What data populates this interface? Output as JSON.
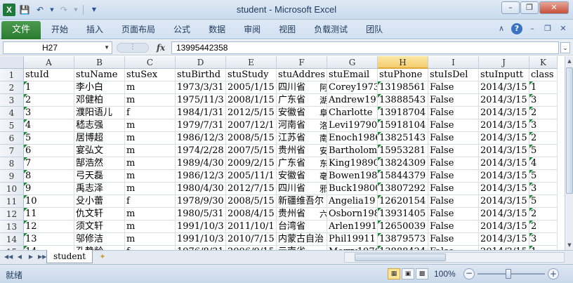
{
  "window": {
    "title": "student  -  Microsoft Excel",
    "icons": [
      "excel-icon",
      "save-icon",
      "undo-icon",
      "redo-icon",
      "minimize-icon",
      "restore-icon",
      "close-icon"
    ]
  },
  "ribbon": {
    "file_tab": "文件",
    "tabs": [
      "开始",
      "插入",
      "页面布局",
      "公式",
      "数据",
      "审阅",
      "视图",
      "负载测试",
      "团队"
    ]
  },
  "formula_bar": {
    "name_box": "H27",
    "fx": "fx",
    "value": "13995442358"
  },
  "columns": [
    "A",
    "B",
    "C",
    "D",
    "E",
    "F",
    "G",
    "H",
    "I",
    "J",
    "K"
  ],
  "selected_column": "H",
  "headers": [
    "stuId",
    "stuName",
    "stuSex",
    "stuBirthd",
    "stuStudy",
    "stuAddres",
    "stuEmail",
    "stuPhone",
    "stuIsDel",
    "stuInputt",
    "class"
  ],
  "rows": [
    [
      "1",
      "李小白",
      "m",
      "1973/3/31",
      "2005/1/15",
      "四川省",
      "阿",
      "Corey1973",
      "13198561",
      "False",
      "2014/3/15",
      "1"
    ],
    [
      "2",
      "邓健柏",
      "m",
      "1975/11/3",
      "2008/1/15",
      "广东省",
      "湖",
      "Andrew197",
      "13888543",
      "False",
      "2014/3/15",
      "3"
    ],
    [
      "3",
      "濮阳语儿",
      "f",
      "1984/1/31",
      "2012/5/15",
      "安徽省",
      "阜",
      "Charlotte",
      "13918704",
      "False",
      "2014/3/15",
      "2"
    ],
    [
      "4",
      "嵇志强",
      "m",
      "1979/7/31",
      "2007/12/1",
      "河南省",
      "洛",
      "Levi19790",
      "15918104",
      "False",
      "2014/3/15",
      "3"
    ],
    [
      "5",
      "居博超",
      "m",
      "1986/12/3",
      "2008/5/15",
      "江苏省",
      "南",
      "Enoch1986",
      "13825143",
      "False",
      "2014/3/15",
      "2"
    ],
    [
      "6",
      "宴弘文",
      "m",
      "1974/2/28",
      "2007/5/15",
      "贵州省",
      "安",
      "Bartholom",
      "15953281",
      "False",
      "2014/3/15",
      "5"
    ],
    [
      "7",
      "郜浩然",
      "m",
      "1989/4/30",
      "2009/2/15",
      "广东省",
      "东",
      "King19890",
      "13824309",
      "False",
      "2014/3/15",
      "4"
    ],
    [
      "8",
      "弓天磊",
      "m",
      "1986/12/3",
      "2005/11/1",
      "安徽省",
      "亳",
      "Bowen1986",
      "15844379",
      "False",
      "2014/3/15",
      "5"
    ],
    [
      "9",
      "禹志泽",
      "m",
      "1980/4/30",
      "2012/7/15",
      "四川省",
      "邪",
      "Buck19800",
      "13807292",
      "False",
      "2014/3/15",
      "3"
    ],
    [
      "10",
      "殳小蕾",
      "f",
      "1978/9/30",
      "2008/5/15",
      "新疆维吾尔",
      "",
      "Angelia19",
      "12620154",
      "False",
      "2014/3/15",
      "5"
    ],
    [
      "11",
      "仇文轩",
      "m",
      "1980/5/31",
      "2008/4/15",
      "贵州省",
      "六",
      "Osborn198",
      "13931405",
      "False",
      "2014/3/15",
      "2"
    ],
    [
      "12",
      "须文轩",
      "m",
      "1991/10/3",
      "2011/10/1",
      "台湾省",
      "",
      "Arlen1991",
      "12650039",
      "False",
      "2014/3/15",
      "2"
    ],
    [
      "13",
      "邬修洁",
      "m",
      "1991/10/3",
      "2010/7/15",
      "内蒙古自治",
      "",
      "Phil19911",
      "13879573",
      "False",
      "2014/3/15",
      "3"
    ],
    [
      "14",
      "孔静龄",
      "f",
      "1976/8/31",
      "2006/9/15",
      "云南省",
      "",
      "Merry1976",
      "13888424",
      "False",
      "2014/3/15",
      "1"
    ]
  ],
  "sheet_tabs": [
    "student"
  ],
  "status": {
    "ready": "就绪",
    "zoom": "100%"
  }
}
